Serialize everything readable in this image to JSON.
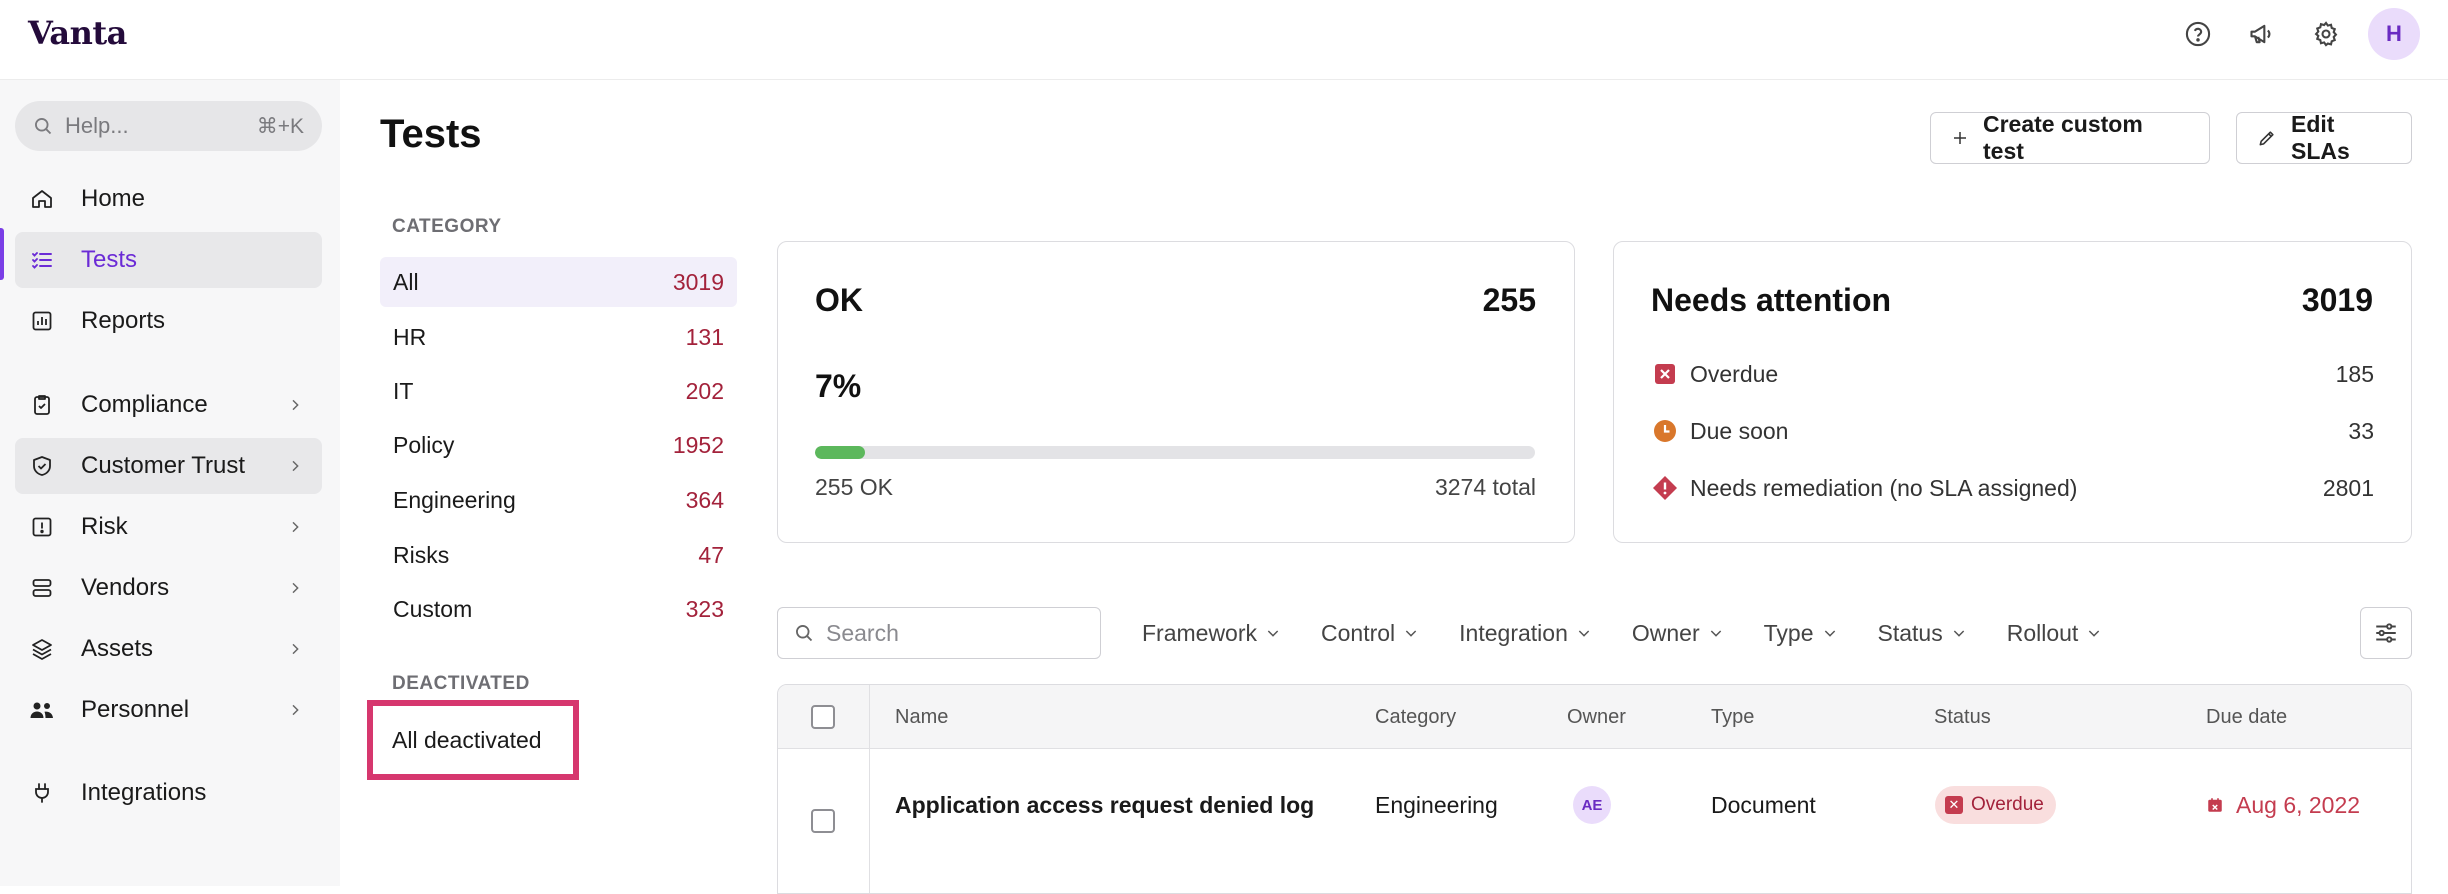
{
  "app": {
    "logo": "Vanta",
    "avatar_initial": "H"
  },
  "top_icons": [
    "help-circle-icon",
    "megaphone-icon",
    "gear-icon"
  ],
  "sidebar": {
    "search": {
      "placeholder": "Help...",
      "shortcut": "⌘+K"
    },
    "items": [
      {
        "label": "Home",
        "icon": "home-icon"
      },
      {
        "label": "Tests",
        "icon": "checklist-icon",
        "active": true
      },
      {
        "label": "Reports",
        "icon": "bar-chart-icon"
      },
      {
        "label": "Compliance",
        "icon": "clipboard-check-icon",
        "has_children": true
      },
      {
        "label": "Customer Trust",
        "icon": "shield-check-icon",
        "has_children": true
      },
      {
        "label": "Risk",
        "icon": "alert-square-icon",
        "has_children": true
      },
      {
        "label": "Vendors",
        "icon": "database-icon",
        "has_children": true
      },
      {
        "label": "Assets",
        "icon": "layers-icon",
        "has_children": true
      },
      {
        "label": "Personnel",
        "icon": "people-icon",
        "has_children": true
      },
      {
        "label": "Integrations",
        "icon": "plug-icon"
      }
    ]
  },
  "main": {
    "title": "Tests",
    "buttons": {
      "create": "Create custom test",
      "edit": "Edit SLAs"
    },
    "category": {
      "header": "CATEGORY",
      "items": [
        {
          "label": "All",
          "count": "3019",
          "active": true
        },
        {
          "label": "HR",
          "count": "131"
        },
        {
          "label": "IT",
          "count": "202"
        },
        {
          "label": "Policy",
          "count": "1952"
        },
        {
          "label": "Engineering",
          "count": "364"
        },
        {
          "label": "Risks",
          "count": "47"
        },
        {
          "label": "Custom",
          "count": "323"
        }
      ],
      "deactivated_header": "DEACTIVATED",
      "deactivated_item": "All deactivated"
    },
    "ok_card": {
      "title": "OK",
      "count": "255",
      "percent": "7%",
      "progress_fraction": 0.07,
      "left_label": "255 OK",
      "right_label": "3274 total"
    },
    "attention_card": {
      "title": "Needs attention",
      "count": "3019",
      "rows": [
        {
          "label": "Overdue",
          "value": "185",
          "icon": "overdue-x-icon",
          "color": "#c43c4f"
        },
        {
          "label": "Due soon",
          "value": "33",
          "icon": "clock-icon",
          "color": "#d9772b"
        },
        {
          "label": "Needs remediation (no SLA assigned)",
          "value": "2801",
          "icon": "alert-diamond-icon",
          "color": "#c43c4f"
        }
      ]
    },
    "search": {
      "placeholder": "Search"
    },
    "filters": [
      "Framework",
      "Control",
      "Integration",
      "Owner",
      "Type",
      "Status",
      "Rollout"
    ],
    "table": {
      "columns": [
        "Name",
        "Category",
        "Owner",
        "Type",
        "Status",
        "Due date"
      ],
      "rows": [
        {
          "name": "Application access request denied log",
          "category": "Engineering",
          "owner": "AE",
          "type": "Document",
          "status": "Overdue",
          "due": "Aug 6, 2022"
        }
      ]
    }
  }
}
